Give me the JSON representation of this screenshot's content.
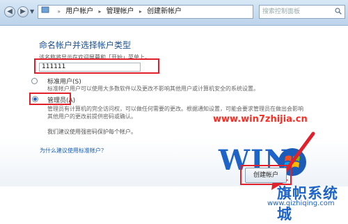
{
  "header": {
    "breadcrumbs": [
      "用户帐户",
      "管理帐户",
      "创建新帐户"
    ],
    "search_placeholder": "搜索控制面板"
  },
  "main": {
    "heading": "命名帐户并选择帐户类型",
    "subtext": "该名称将显示在欢迎屏幕和「开始」菜单上。",
    "account_name": "111111",
    "options": [
      {
        "label": "标准用户(S)",
        "description": "标准帐户用户可以使用大多数软件以及更改不影响其他用户或计算机安全的系统设置。",
        "checked": false
      },
      {
        "label": "管理员(A)",
        "description_line1": "管理员有计算机的完全访问权，可以做任何需要的更改。根据通知设置，可能会要求管理员在做出会影响",
        "description_line2": "其他用户的更改前提供密码或确认。",
        "checked": true
      }
    ],
    "recommend": "我们建议使用强密码保护每个帐户。",
    "why_link": "为什么建议使用标准帐户？",
    "create_button": "创建帐户"
  },
  "watermark": {
    "url": "www.win7zhijia.cn",
    "logo_text": "WIN",
    "brand": "旗帜系统城",
    "brand_url": "www.qizhiqing.com"
  },
  "colors": {
    "highlight": "#e0202a",
    "heading": "#1e4f8f",
    "link": "#1a5db3"
  }
}
